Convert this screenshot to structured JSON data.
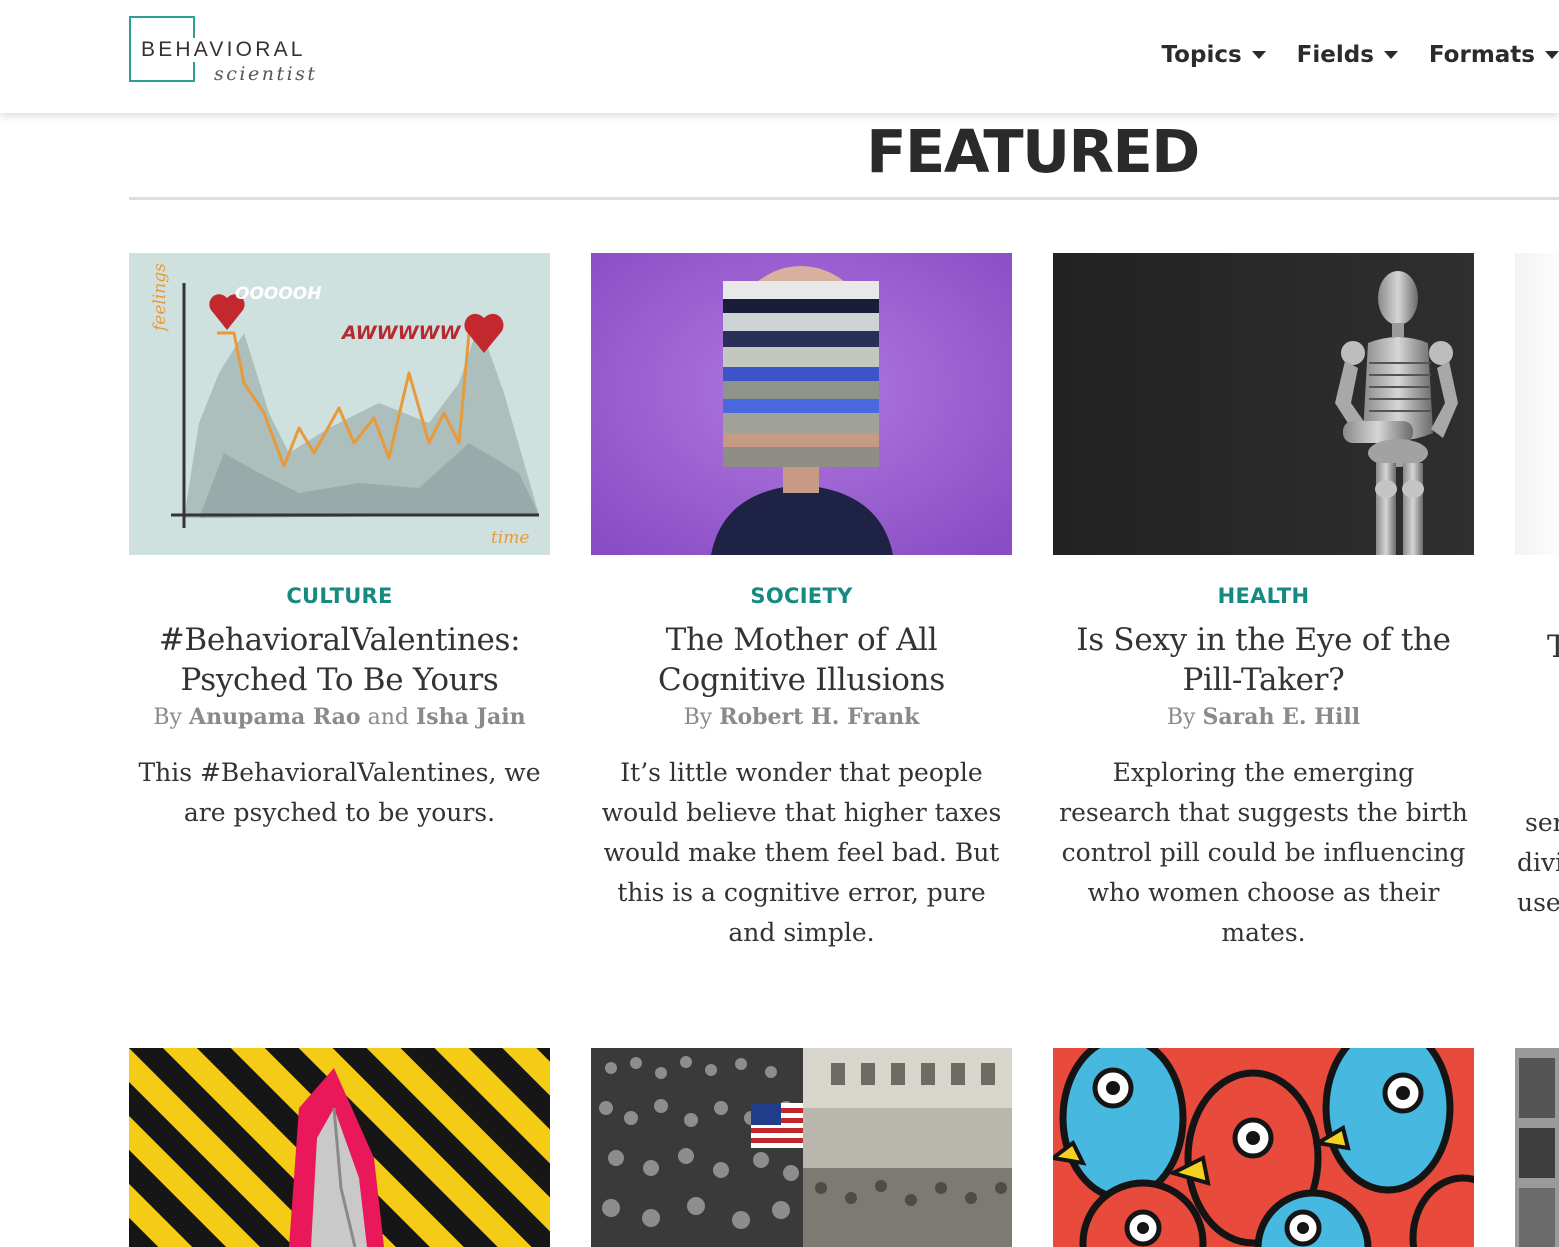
{
  "header": {
    "logo_top": "BEHAVIORAL",
    "logo_bottom": "scientist",
    "nav": [
      {
        "label": "Topics"
      },
      {
        "label": "Fields"
      },
      {
        "label": "Formats"
      }
    ]
  },
  "section_title": "FEATURED",
  "cards": [
    {
      "category": "CULTURE",
      "title_lines": [
        "#BehavioralValentines:",
        "Psyched To Be Yours"
      ],
      "by": "By",
      "author1": "Anupama Rao",
      "and": "and",
      "author2": "Isha Jain",
      "excerpt_lines": [
        "This #BehavioralValentines, we",
        "are psyched to be yours."
      ],
      "image": {
        "chart_words": [
          "OOOOOH",
          "AWWWWW",
          "feelings",
          "time"
        ],
        "colors": {
          "bg": "#cfe1df",
          "line": "#e89a3a",
          "heart": "#c2282e"
        }
      }
    },
    {
      "category": "SOCIETY",
      "title_lines": [
        "The Mother of All",
        "Cognitive Illusions"
      ],
      "by": "By",
      "author1": "Robert H. Frank",
      "excerpt_lines": [
        "It’s little wonder that people",
        "would believe that higher taxes",
        "would make them feel bad. But",
        "this is a cognitive error, pure",
        "and simple."
      ],
      "image": {
        "colors": {
          "bg": "#9b5bd0"
        }
      }
    },
    {
      "category": "HEALTH",
      "title_lines": [
        "Is Sexy in the Eye of the",
        "Pill-Taker?"
      ],
      "by": "By",
      "author1": "Sarah E. Hill",
      "excerpt_lines": [
        "Exploring the emerging",
        "research that suggests the birth",
        "control pill could be influencing",
        "who women choose as their",
        "mates."
      ],
      "image": {
        "colors": {
          "bg": "#2a2a2a"
        }
      }
    }
  ],
  "card4_fragments": [
    "T",
    "ser",
    "divi",
    "use"
  ],
  "colors": {
    "accent": "#168a80",
    "logo_border": "#2f9e97"
  }
}
